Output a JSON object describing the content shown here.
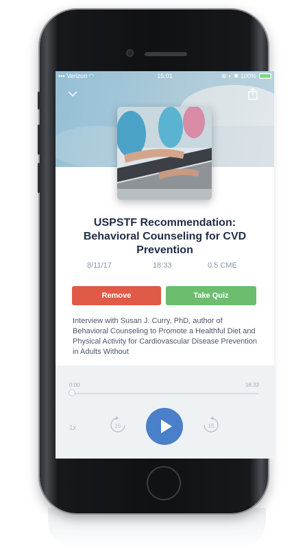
{
  "status_bar": {
    "carrier": "Verizon",
    "time": "15:01",
    "battery": "100%"
  },
  "episode": {
    "title": "USPSTF Recommendation: Behavioral Counseling for CVD Prevention",
    "date": "8/11/17",
    "duration": "18:33",
    "credit": "0.5 CME",
    "description": "Interview with Susan J. Curry, PhD, author of Behavioral Counseling to Promote a Healthful Diet and Physical Activity for Cardiovascular Disease Prevention in Adults Without"
  },
  "actions": {
    "remove_label": "Remove",
    "quiz_label": "Take Quiz"
  },
  "player": {
    "elapsed": "0:00",
    "total": "18:33",
    "progress_fraction": 0,
    "speed": "1x",
    "skip_back": "15",
    "skip_forward": "15"
  },
  "colors": {
    "remove": "#e05a48",
    "quiz": "#6cbd6e",
    "play": "#4a7fc9",
    "title": "#1f2d45"
  },
  "icons": [
    "chevron-down-icon",
    "share-icon",
    "rewind-15-icon",
    "play-icon",
    "forward-15-icon",
    "wifi-icon",
    "battery-icon"
  ]
}
